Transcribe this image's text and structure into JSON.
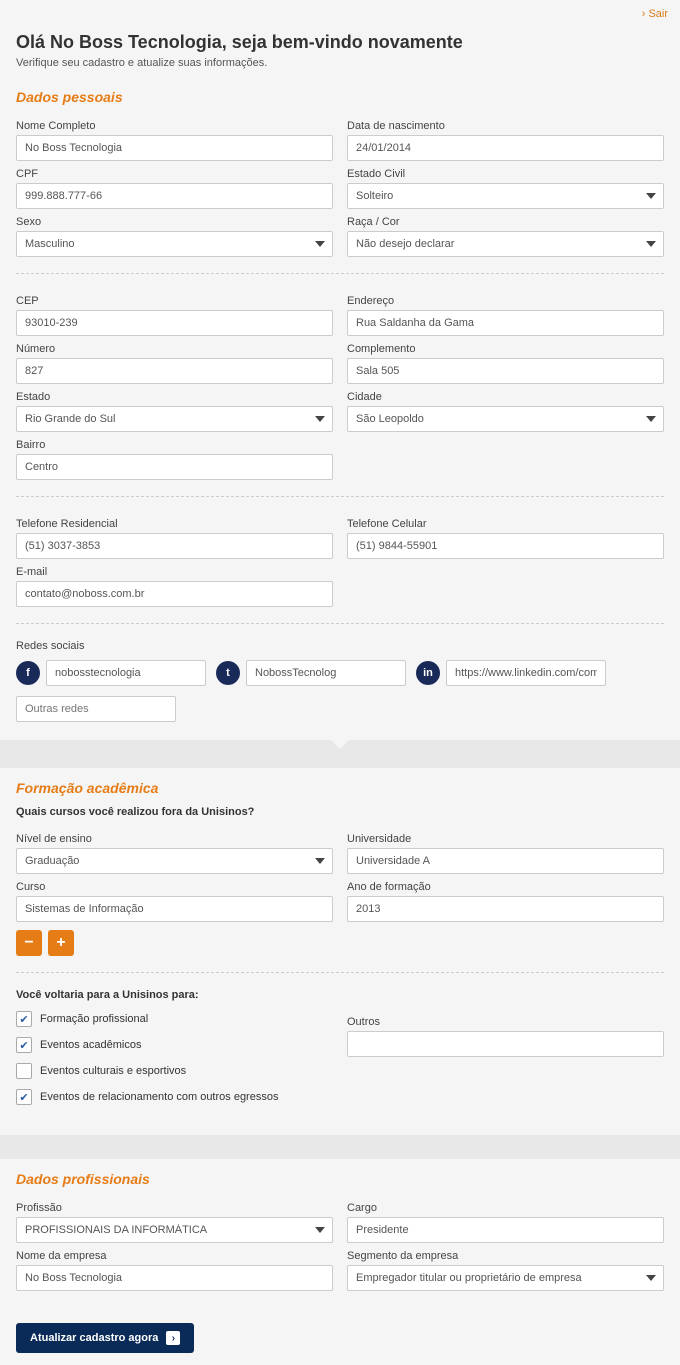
{
  "topbar": {
    "exit": "Sair"
  },
  "header": {
    "title": "Olá No Boss Tecnologia, seja bem-vindo novamente",
    "subtitle": "Verifique seu cadastro e atualize suas informações."
  },
  "personal": {
    "title": "Dados pessoais",
    "name_label": "Nome Completo",
    "name": "No Boss Tecnologia",
    "dob_label": "Data de nascimento",
    "dob": "24/01/2014",
    "cpf_label": "CPF",
    "cpf": "999.888.777-66",
    "civil_label": "Estado Civil",
    "civil": "Solteiro",
    "sex_label": "Sexo",
    "sex": "Masculino",
    "race_label": "Raça / Cor",
    "race": "Não desejo declarar",
    "cep_label": "CEP",
    "cep": "93010-239",
    "address_label": "Endereço",
    "address": "Rua Saldanha da Gama",
    "number_label": "Número",
    "number": "827",
    "comp_label": "Complemento",
    "comp": "Sala 505",
    "state_label": "Estado",
    "state": "Rio Grande do Sul",
    "city_label": "Cidade",
    "city": "São Leopoldo",
    "district_label": "Bairro",
    "district": "Centro",
    "phone_label": "Telefone Residencial",
    "phone": "(51) 3037-3853",
    "cell_label": "Telefone Celular",
    "cell": "(51) 9844-55901",
    "email_label": "E-mail",
    "email": "contato@noboss.com.br",
    "social_label": "Redes sociais",
    "facebook": "nobosstecnologia",
    "twitter": "NobossTecnolog",
    "linkedin": "https://www.linkedin.com/company",
    "other_placeholder": "Outras redes"
  },
  "academic": {
    "title": "Formação acadêmica",
    "question": "Quais cursos você realizou fora da Unisinos?",
    "level_label": "Nível de ensino",
    "level": "Graduação",
    "university_label": "Universidade",
    "university": "Universidade A",
    "course_label": "Curso",
    "course": "Sistemas de Informação",
    "year_label": "Ano de formação",
    "year": "2013",
    "return_question": "Você voltaria para a Unisinos para:",
    "c1": "Formação profissional",
    "c2": "Eventos acadêmicos",
    "c3": "Eventos culturais e esportivos",
    "c4": "Eventos de relacionamento com outros egressos",
    "others_label": "Outros"
  },
  "professional": {
    "title": "Dados profissionais",
    "profession_label": "Profissão",
    "profession": "PROFISSIONAIS DA INFORMÁTICA",
    "position_label": "Cargo",
    "position": "Presidente",
    "company_label": "Nome da empresa",
    "company": "No Boss Tecnologia",
    "segment_label": "Segmento da empresa",
    "segment": "Empregador titular ou proprietário de empresa"
  },
  "actions": {
    "submit": "Atualizar cadastro agora"
  }
}
